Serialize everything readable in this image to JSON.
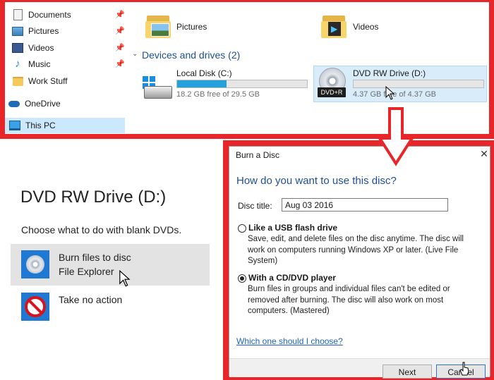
{
  "explorer": {
    "nav_items": [
      {
        "label": "Documents",
        "icon": "documents-icon",
        "pinned": true
      },
      {
        "label": "Pictures",
        "icon": "pictures-icon",
        "pinned": true
      },
      {
        "label": "Videos",
        "icon": "videos-icon",
        "pinned": true
      },
      {
        "label": "Music",
        "icon": "music-icon",
        "pinned": true
      },
      {
        "label": "Work Stuff",
        "icon": "folder-icon",
        "pinned": false
      },
      {
        "label": "OneDrive",
        "icon": "onedrive-icon",
        "pinned": false
      },
      {
        "label": "This PC",
        "icon": "this-pc-icon",
        "pinned": false,
        "selected": true
      }
    ],
    "quick_folders": [
      {
        "label": "Pictures",
        "icon": "pictures-folder-icon"
      },
      {
        "label": "Videos",
        "icon": "videos-folder-icon"
      }
    ],
    "devices_section_title": "Devices and drives (2)",
    "drives": [
      {
        "name": "Local Disk (C:)",
        "free_text": "18.2 GB free of 29.5 GB",
        "used_fraction": 0.38,
        "icon": "hard-disk-icon"
      },
      {
        "name": "DVD RW Drive (D:)",
        "free_text": "4.37 GB free of 4.37 GB",
        "used_fraction": 0.0,
        "icon": "dvd-drive-icon",
        "badge": "DVD+R",
        "selected": true
      }
    ]
  },
  "autoplay": {
    "title": "DVD RW Drive (D:)",
    "subtitle": "Choose what to do with blank DVDs.",
    "options": [
      {
        "line1": "Burn files to disc",
        "line2": "File Explorer",
        "icon": "disc-icon"
      },
      {
        "line1": "Take no action",
        "line2": "",
        "icon": "no-action-icon"
      }
    ]
  },
  "dialog": {
    "title": "Burn a Disc",
    "question": "How do you want to use this disc?",
    "disc_title_label": "Disc title:",
    "disc_title_value": "Aug 03 2016",
    "option_usb": {
      "label": "Like a USB flash drive",
      "description": "Save, edit, and delete files on the disc anytime. The disc will work on computers running Windows XP or later. (Live File System)",
      "checked": false
    },
    "option_cd": {
      "label": "With a CD/DVD player",
      "description": "Burn files in groups and individual files can't be edited or removed after burning. The disc will also work on most computers. (Mastered)",
      "checked": true
    },
    "help_link": "Which one should I choose?",
    "next_label": "Next",
    "cancel_label": "Cancel"
  },
  "colors": {
    "highlight_frame": "#e8262a",
    "accent_blue": "#1f4f96",
    "storage_bar": "#26a0da"
  }
}
